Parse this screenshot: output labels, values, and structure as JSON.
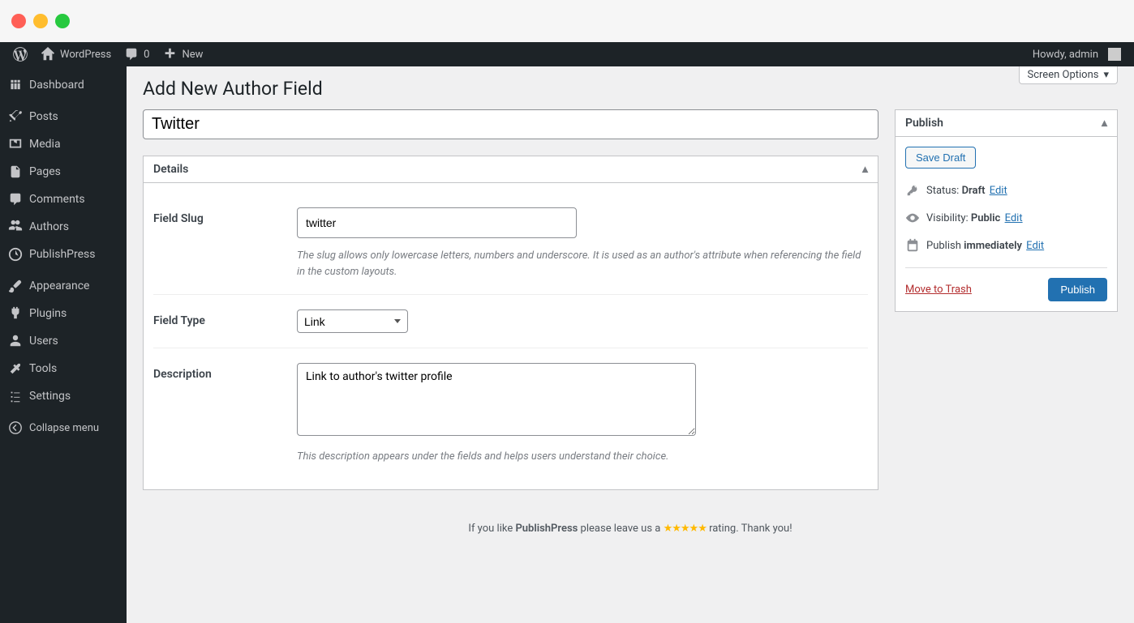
{
  "admin_bar": {
    "site_name": "WordPress",
    "comments_count": "0",
    "new_label": "New",
    "howdy": "Howdy, admin"
  },
  "sidebar": {
    "items": [
      {
        "label": "Dashboard",
        "icon": "dashboard"
      },
      {
        "label": "Posts",
        "icon": "pin"
      },
      {
        "label": "Media",
        "icon": "media"
      },
      {
        "label": "Pages",
        "icon": "page"
      },
      {
        "label": "Comments",
        "icon": "comment"
      },
      {
        "label": "Authors",
        "icon": "groups"
      },
      {
        "label": "PublishPress",
        "icon": "publishpress"
      },
      {
        "label": "Appearance",
        "icon": "brush"
      },
      {
        "label": "Plugins",
        "icon": "plug"
      },
      {
        "label": "Users",
        "icon": "user"
      },
      {
        "label": "Tools",
        "icon": "wrench"
      },
      {
        "label": "Settings",
        "icon": "sliders"
      }
    ],
    "collapse": "Collapse menu"
  },
  "screen_options": "Screen Options",
  "page_title": "Add New Author Field",
  "title_field": {
    "value": "Twitter"
  },
  "details": {
    "heading": "Details",
    "field_slug": {
      "label": "Field Slug",
      "value": "twitter",
      "description": "The slug allows only lowercase letters, numbers and underscore. It is used as an author's attribute when referencing the field in the custom layouts."
    },
    "field_type": {
      "label": "Field Type",
      "value": "Link"
    },
    "description_field": {
      "label": "Description",
      "value": "Link to author's twitter profile",
      "description": "This description appears under the fields and helps users understand their choice."
    }
  },
  "publish": {
    "heading": "Publish",
    "save_draft": "Save Draft",
    "status_label": "Status:",
    "status_value": "Draft",
    "status_edit": "Edit",
    "visibility_label": "Visibility:",
    "visibility_value": "Public",
    "visibility_edit": "Edit",
    "schedule_label": "Publish",
    "schedule_value": "immediately",
    "schedule_edit": "Edit",
    "trash": "Move to Trash",
    "publish_btn": "Publish"
  },
  "footer": {
    "pre": "If you like ",
    "brand": "PublishPress",
    "mid": " please leave us a ",
    "stars": "★★★★★",
    "post": " rating. Thank you!"
  }
}
